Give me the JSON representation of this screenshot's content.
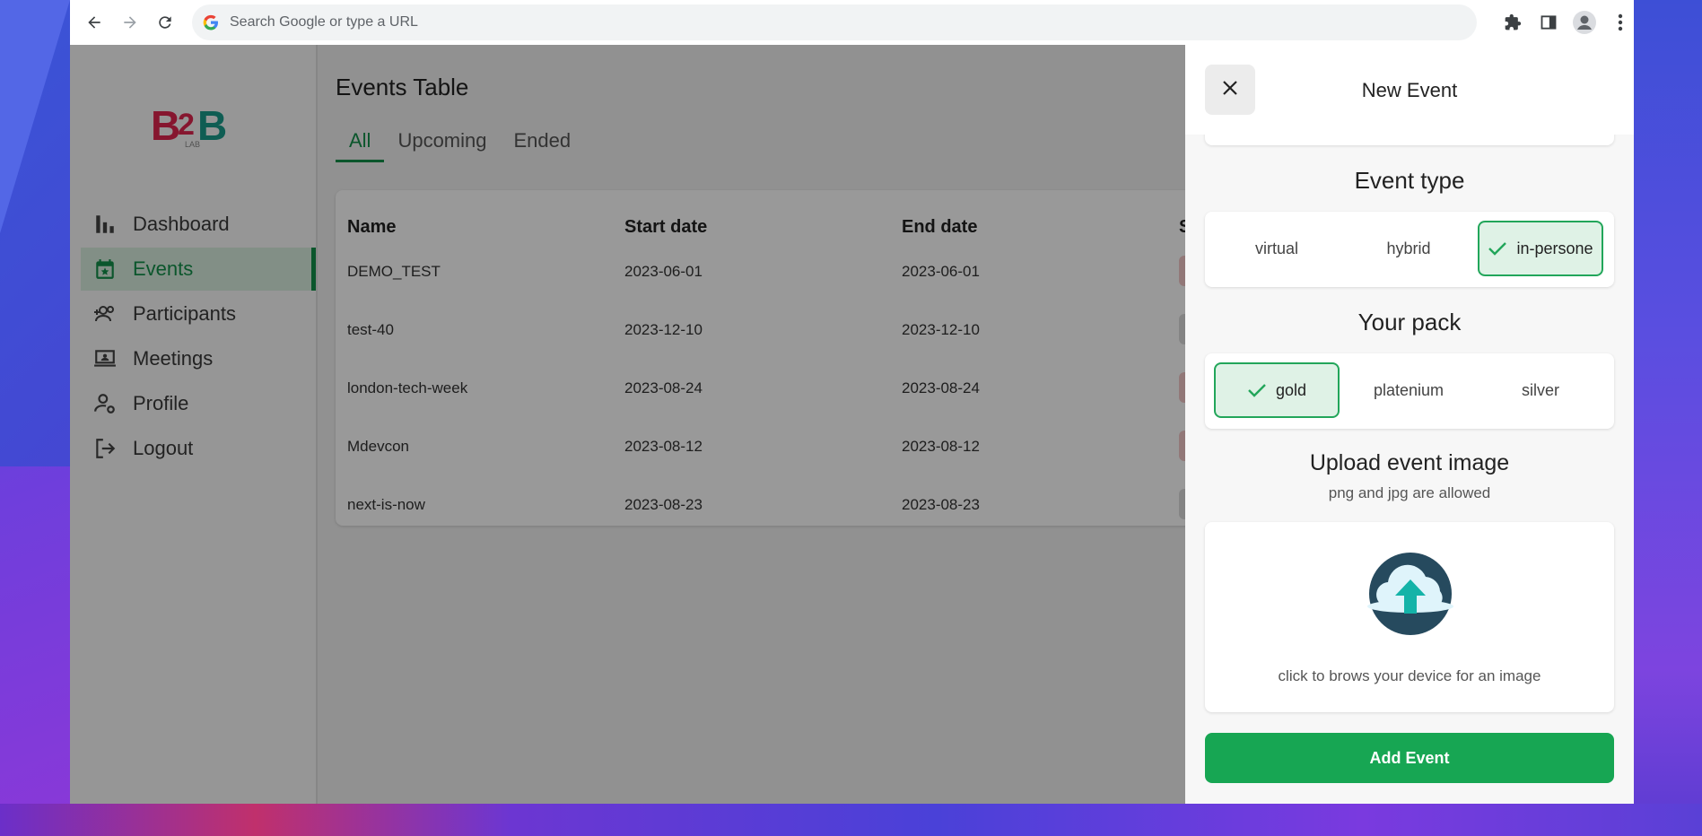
{
  "browser": {
    "omnibox_placeholder": "Search Google or type a URL",
    "icons": [
      "back-arrow-icon",
      "forward-arrow-icon",
      "reload-icon",
      "google-g-icon",
      "extensions-puzzle-icon",
      "side-panel-icon",
      "profile-avatar-icon",
      "kebab-menu-icon"
    ]
  },
  "sidebar": {
    "logo": {
      "main": "B2B",
      "sub": "LAB",
      "colors": {
        "b1": "#e0264f",
        "two": "#e0264f",
        "b2": "#1a9b8a"
      }
    },
    "items": [
      {
        "label": "Dashboard",
        "icon": "bar-chart-icon",
        "active": false
      },
      {
        "label": "Events",
        "icon": "calendar-star-icon",
        "active": true
      },
      {
        "label": "Participants",
        "icon": "group-add-icon",
        "active": false
      },
      {
        "label": "Meetings",
        "icon": "laptop-person-icon",
        "active": false
      },
      {
        "label": "Profile",
        "icon": "person-settings-icon",
        "active": false
      },
      {
        "label": "Logout",
        "icon": "logout-icon",
        "active": false
      }
    ]
  },
  "main": {
    "title": "Events Table",
    "tabs": [
      {
        "label": "All",
        "active": true
      },
      {
        "label": "Upcoming",
        "active": false
      },
      {
        "label": "Ended",
        "active": false
      }
    ],
    "table": {
      "columns": [
        "Name",
        "Start date",
        "End date",
        "S"
      ],
      "rows": [
        {
          "name": "DEMO_TEST",
          "start": "2023-06-01",
          "end": "2023-06-01",
          "status_color": "#f3c9c9"
        },
        {
          "name": "test-40",
          "start": "2023-12-10",
          "end": "2023-12-10",
          "status_color": "#dcdcdc"
        },
        {
          "name": "london-tech-week",
          "start": "2023-08-24",
          "end": "2023-08-24",
          "status_color": "#f3c9c9"
        },
        {
          "name": "Mdevcon",
          "start": "2023-08-12",
          "end": "2023-08-12",
          "status_color": "#f3c9c9"
        },
        {
          "name": "next-is-now",
          "start": "2023-08-23",
          "end": "2023-08-23",
          "status_color": "#dcdcdc"
        }
      ]
    }
  },
  "drawer": {
    "title": "New Event",
    "event_type": {
      "title": "Event type",
      "options": [
        {
          "label": "virtual",
          "selected": false
        },
        {
          "label": "hybrid",
          "selected": false
        },
        {
          "label": "in-persone",
          "selected": true
        }
      ]
    },
    "pack": {
      "title": "Your pack",
      "options": [
        {
          "label": "gold",
          "selected": true
        },
        {
          "label": "platenium",
          "selected": false
        },
        {
          "label": "silver",
          "selected": false
        }
      ]
    },
    "upload": {
      "title": "Upload event image",
      "subtitle": "png and jpg are allowed",
      "prompt": "click to brows your device for an image"
    },
    "submit_label": "Add Event"
  },
  "colors": {
    "accent": "#13904a",
    "button": "#17a653",
    "selected_bg": "#dff2e6"
  }
}
